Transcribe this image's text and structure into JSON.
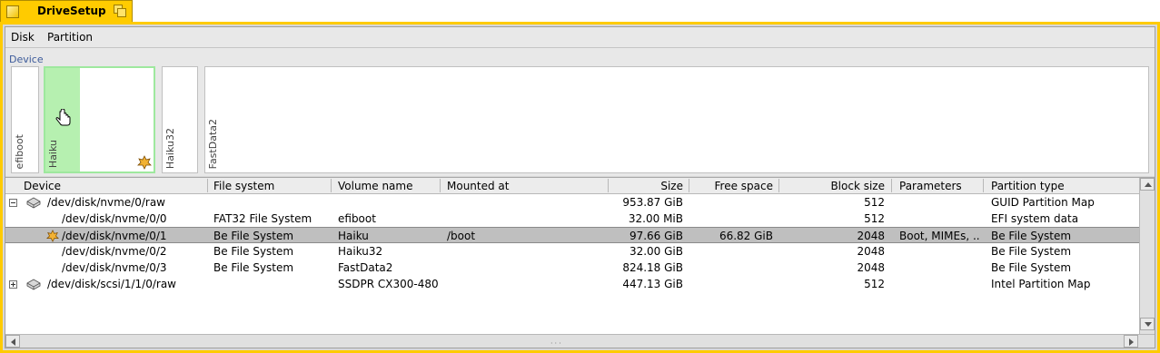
{
  "window": {
    "title": "DriveSetup"
  },
  "menu": {
    "disk": "Disk",
    "partition": "Partition"
  },
  "device_panel": {
    "label": "Device",
    "partitions": [
      {
        "label": "efiboot"
      },
      {
        "label": "Haiku",
        "selected": true,
        "used_fraction": 0.316
      },
      {
        "label": "Haiku32"
      },
      {
        "label": "FastData2"
      }
    ],
    "selected_color": "#b6f0b0"
  },
  "columns": [
    "Device",
    "File system",
    "Volume name",
    "Mounted at",
    "Size",
    "Free space",
    "Block size",
    "Parameters",
    "Partition type"
  ],
  "rows": [
    {
      "device": "/dev/disk/nvme/0/raw",
      "fs": "",
      "volume": "",
      "mount": "",
      "size": "953.87 GiB",
      "free": "",
      "block": "512",
      "params": "",
      "ptype": "GUID Partition Map"
    },
    {
      "device": "/dev/disk/nvme/0/0",
      "fs": "FAT32 File System",
      "volume": "efiboot",
      "mount": "",
      "size": "32.00 MiB",
      "free": "",
      "block": "512",
      "params": "",
      "ptype": "EFI system data"
    },
    {
      "device": "/dev/disk/nvme/0/1",
      "fs": "Be File System",
      "volume": "Haiku",
      "mount": "/boot",
      "size": "97.66 GiB",
      "free": "66.82 GiB",
      "block": "2048",
      "params": "Boot, MIMEs, ...",
      "ptype": "Be File System"
    },
    {
      "device": "/dev/disk/nvme/0/2",
      "fs": "Be File System",
      "volume": "Haiku32",
      "mount": "",
      "size": "32.00 GiB",
      "free": "",
      "block": "2048",
      "params": "",
      "ptype": "Be File System"
    },
    {
      "device": "/dev/disk/nvme/0/3",
      "fs": "Be File System",
      "volume": "FastData2",
      "mount": "",
      "size": "824.18 GiB",
      "free": "",
      "block": "2048",
      "params": "",
      "ptype": "Be File System"
    },
    {
      "device": "/dev/disk/scsi/1/1/0/raw",
      "fs": "",
      "volume": "SSDPR CX300-480",
      "mount": "",
      "size": "447.13 GiB",
      "free": "",
      "block": "512",
      "params": "",
      "ptype": "Intel Partition Map"
    }
  ]
}
